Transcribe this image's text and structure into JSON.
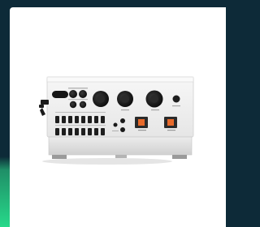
{
  "image": {
    "subject": "inverter",
    "colors": {
      "page_bg": "#0d2a38",
      "accent_green": "#27d98a",
      "card": "#ffffff",
      "housing": "#f2f2f2",
      "housing_shadow": "#d9d9d9",
      "connector": "#1c1c1c",
      "switch": "#e86a2b"
    }
  }
}
